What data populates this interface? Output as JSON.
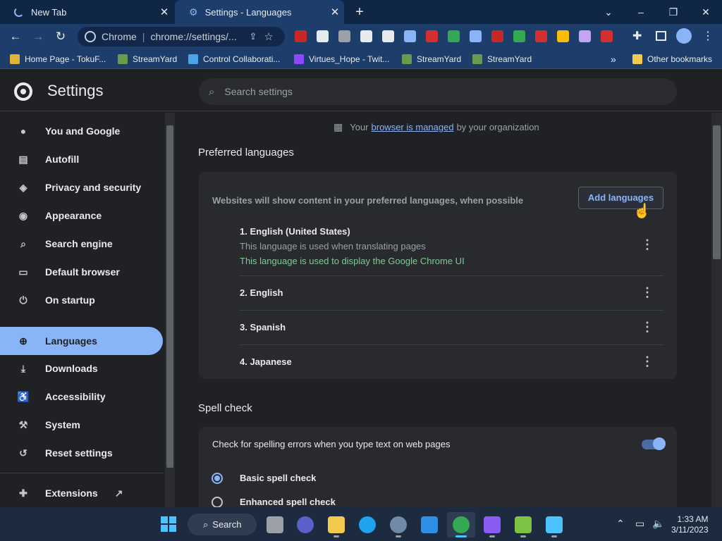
{
  "browser": {
    "tabs": [
      {
        "title": "New Tab"
      },
      {
        "title": "Settings - Languages"
      }
    ],
    "omnibox": {
      "chip": "Chrome",
      "url": "chrome://settings/..."
    },
    "bookmarks": [
      {
        "label": "Home Page - TokuF..."
      },
      {
        "label": "StreamYard"
      },
      {
        "label": "Control Collaborati..."
      },
      {
        "label": "Virtues_Hope - Twit..."
      },
      {
        "label": "StreamYard"
      },
      {
        "label": "StreamYard"
      }
    ],
    "bookmarks_more": "»",
    "other_bookmarks": "Other bookmarks",
    "extension_colors": [
      "#c62828",
      "#e8eaed",
      "#9aa0a6",
      "#e8eaed",
      "#e8eaed",
      "#8ab4f8",
      "#d32f2f",
      "#34a853",
      "#8ab4f8",
      "#c62828",
      "#34a853",
      "#d32f2f",
      "#fbbc04",
      "#c5a3f5",
      "#d32f2f"
    ]
  },
  "settings": {
    "title": "Settings",
    "search_placeholder": "Search settings",
    "sidebar": {
      "items": [
        {
          "label": "You and Google",
          "icon": "person-icon"
        },
        {
          "label": "Autofill",
          "icon": "clipboard-icon"
        },
        {
          "label": "Privacy and security",
          "icon": "shield-icon"
        },
        {
          "label": "Appearance",
          "icon": "palette-icon"
        },
        {
          "label": "Search engine",
          "icon": "search-icon"
        },
        {
          "label": "Default browser",
          "icon": "browser-icon"
        },
        {
          "label": "On startup",
          "icon": "power-icon"
        },
        {
          "label": "Languages",
          "icon": "globe-icon",
          "active": true
        },
        {
          "label": "Downloads",
          "icon": "download-icon"
        },
        {
          "label": "Accessibility",
          "icon": "accessibility-icon"
        },
        {
          "label": "System",
          "icon": "wrench-icon"
        },
        {
          "label": "Reset settings",
          "icon": "history-icon"
        }
      ],
      "extensions": "Extensions"
    },
    "managed": {
      "prefix": "Your",
      "link": "browser is managed",
      "suffix": "by your organization"
    },
    "preferred_languages": {
      "heading": "Preferred languages",
      "description": "Websites will show content in your preferred languages, when possible",
      "add_button": "Add languages",
      "languages": [
        {
          "name": "1. English (United States)",
          "note": "This language is used when translating pages",
          "ui_note": "This language is used to display the Google Chrome UI"
        },
        {
          "name": "2. English"
        },
        {
          "name": "3. Spanish"
        },
        {
          "name": "4. Japanese"
        }
      ]
    },
    "spell_check": {
      "heading": "Spell check",
      "description": "Check for spelling errors when you type text on web pages",
      "enabled": true,
      "options": [
        {
          "label": "Basic spell check",
          "selected": true
        },
        {
          "label": "Enhanced spell check",
          "selected": false
        }
      ]
    }
  },
  "taskbar": {
    "search_label": "Search",
    "time": "1:33 AM",
    "date": "3/11/2023"
  }
}
